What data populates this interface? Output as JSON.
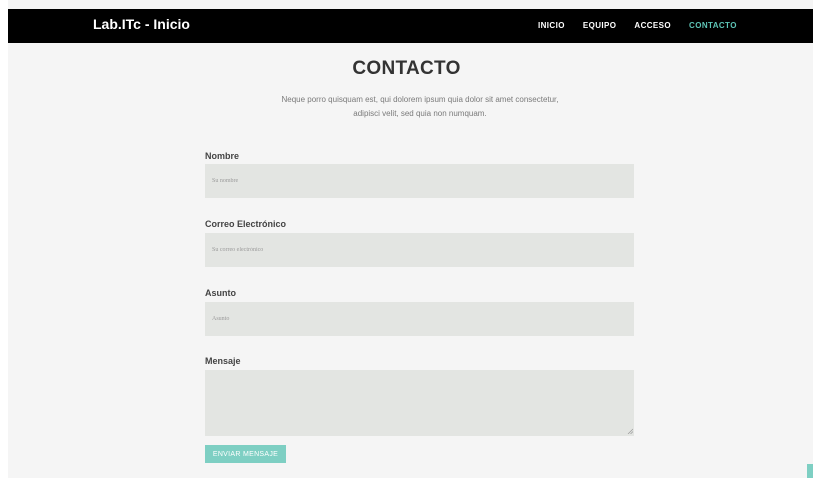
{
  "nav": {
    "brand": "Lab.ITc - Inicio",
    "links": [
      {
        "label": "INICIO",
        "active": false
      },
      {
        "label": "EQUIPO",
        "active": false
      },
      {
        "label": "ACCESO",
        "active": false
      },
      {
        "label": "CONTACTO",
        "active": true
      }
    ]
  },
  "section": {
    "title": "CONTACTO",
    "subtitle_line1": "Neque porro quisquam est, qui dolorem ipsum quia dolor sit amet consectetur,",
    "subtitle_line2": "adipisci velit, sed quia non numquam."
  },
  "form": {
    "name_label": "Nombre",
    "name_placeholder": "Su nombre",
    "email_label": "Correo Electrónico",
    "email_placeholder": "Su correo electrónico",
    "subject_label": "Asunto",
    "subject_placeholder": "Asunto",
    "message_label": "Mensaje",
    "message_placeholder": "",
    "submit_label": "ENVIAR MENSAJE"
  },
  "colors": {
    "accent": "#7ecfc3",
    "nav_active": "#5ec5b7",
    "navbar_bg": "#000000",
    "field_bg": "#e3e5e2"
  }
}
